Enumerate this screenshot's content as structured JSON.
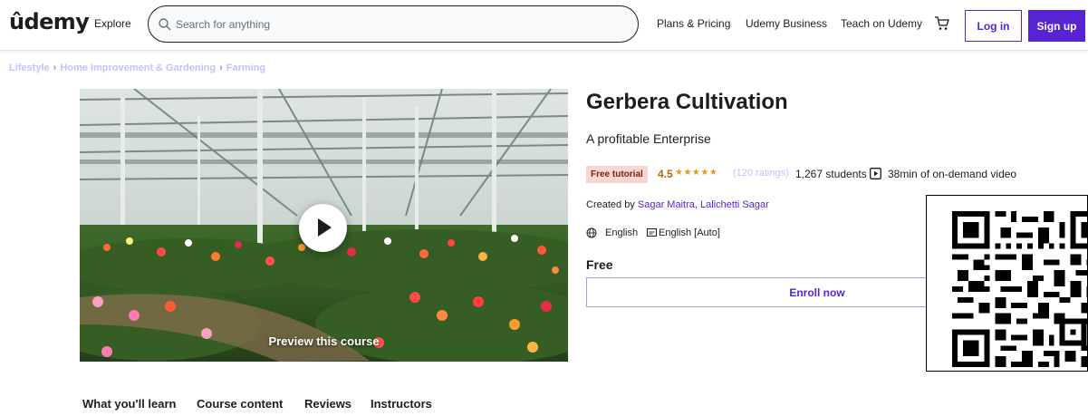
{
  "header": {
    "logo": "ûdemy",
    "explore": "Explore",
    "search_placeholder": "Search for anything",
    "nav": [
      "Plans & Pricing",
      "Udemy Business",
      "Teach on Udemy"
    ],
    "login_label": "Log in",
    "signup_label": "Sign up"
  },
  "breadcrumb": [
    "Lifestyle",
    "Home Improvement & Gardening",
    "Farming"
  ],
  "preview": {
    "label": "Preview this course"
  },
  "course": {
    "title": "Gerbera Cultivation",
    "subtitle": "A profitable Enterprise",
    "badge": "Free tutorial",
    "rating": "4.5",
    "stars": "★★★★★",
    "ratings_count": "(120 ratings)",
    "students": "1,267 students",
    "video": "38min of on-demand video",
    "created_by_prefix": "Created by",
    "authors": "Sagar Maitra, Lalichetti Sagar",
    "language": "English",
    "captions": "English [Auto]",
    "price": "Free",
    "enroll_label": "Enroll now"
  },
  "tabs": [
    "What you'll learn",
    "Course content",
    "Reviews",
    "Instructors"
  ],
  "colors": {
    "brand_purple": "#5624d0",
    "rating_orange": "#b4690e",
    "star_color": "#e59819",
    "badge_bg": "#f8d7d3"
  }
}
